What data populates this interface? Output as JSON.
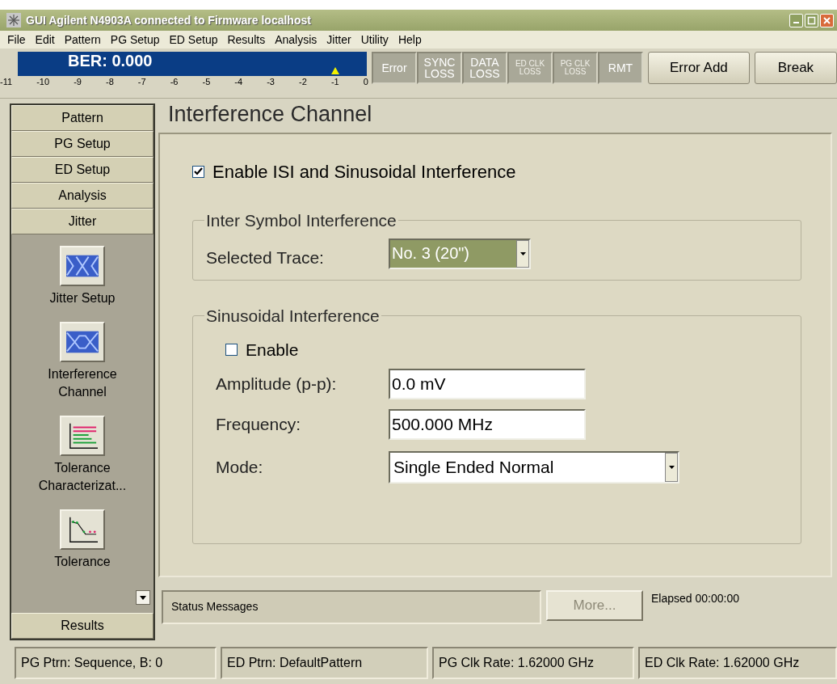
{
  "window": {
    "title": "GUI Agilent N4903A connected to Firmware localhost"
  },
  "menu": [
    "File",
    "Edit",
    "Pattern",
    "PG Setup",
    "ED Setup",
    "Results",
    "Analysis",
    "Jitter",
    "Utility",
    "Help"
  ],
  "ber": {
    "label": "BER: 0.000",
    "scale": [
      "-11",
      "-10",
      "-9",
      "-8",
      "-7",
      "-6",
      "-5",
      "-4",
      "-3",
      "-2",
      "-1",
      "0"
    ],
    "level": 0.91
  },
  "indicators": [
    {
      "lines": [
        "Error"
      ],
      "disabled": false
    },
    {
      "lines": [
        "SYNC",
        "LOSS"
      ],
      "disabled": false
    },
    {
      "lines": [
        "DATA",
        "LOSS"
      ],
      "disabled": false
    },
    {
      "lines": [
        "ED CLK",
        "LOSS"
      ],
      "disabled": true
    },
    {
      "lines": [
        "PG CLK",
        "LOSS"
      ],
      "disabled": true
    },
    {
      "lines": [
        "RMT"
      ],
      "disabled": false
    }
  ],
  "buttons": [
    "Error Add",
    "Break"
  ],
  "nav": {
    "sections_before": [
      "Pattern",
      "PG Setup",
      "ED Setup",
      "Analysis"
    ],
    "expanded": {
      "label": "Jitter",
      "items": [
        {
          "label": "Jitter Setup",
          "kind": "eye"
        },
        {
          "label": "Interference\nChannel",
          "kind": "eye-closed"
        },
        {
          "label": "Tolerance\nCharacterizat...",
          "kind": "tolerance-grid"
        },
        {
          "label": "Tolerance",
          "kind": "tolerance-curve"
        }
      ]
    },
    "sections_after": [
      "Results"
    ]
  },
  "main": {
    "heading": "Interference Channel",
    "enable": {
      "label": "Enable ISI and Sinusoidal Interference",
      "checked": true
    },
    "isi": {
      "title": "Inter Symbol Interference",
      "label": "Selected Trace:",
      "value": "No. 3 (20\")"
    },
    "si": {
      "title": "Sinusoidal Interference",
      "enable": {
        "label": "Enable",
        "checked": false
      },
      "fields": [
        {
          "label": "Amplitude (p-p):",
          "value": "0.0 mV",
          "kind": "text"
        },
        {
          "label": "Frequency:",
          "value": "500.000 MHz",
          "kind": "text"
        },
        {
          "label": "Mode:",
          "value": "Single Ended Normal",
          "kind": "dropdown"
        }
      ]
    }
  },
  "status": {
    "messages": "Status Messages",
    "more": {
      "label": "More...",
      "disabled": true
    },
    "elapsed": "Elapsed 00:00:00"
  },
  "status_bar": [
    "PG Ptrn: Sequence, B: 0",
    "ED Ptrn: DefaultPattern",
    "PG Clk Rate: 1.62000 GHz",
    "ED Clk Rate: 1.62000 GHz"
  ]
}
